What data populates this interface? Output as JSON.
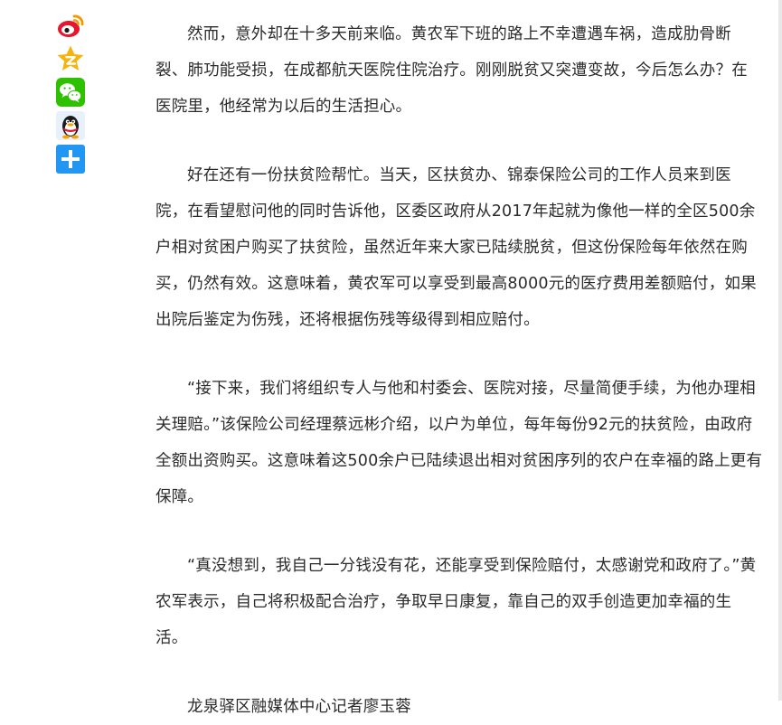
{
  "share": {
    "buttons": [
      {
        "name": "weibo-share-button",
        "icon": "weibo-icon",
        "color": "#e6162d"
      },
      {
        "name": "qzone-share-button",
        "icon": "qzone-star-icon",
        "color": "#f5b40d"
      },
      {
        "name": "wechat-share-button",
        "icon": "wechat-icon",
        "color": "#2dc100"
      },
      {
        "name": "qq-share-button",
        "icon": "qq-penguin-icon",
        "color": "#2a7bd3"
      },
      {
        "name": "more-share-button",
        "icon": "plus-icon",
        "color": "#2196f3"
      }
    ]
  },
  "article": {
    "paragraphs": [
      "然而，意外却在十多天前来临。黄农军下班的路上不幸遭遇车祸，造成肋骨断裂、肺功能受损，在成都航天医院住院治疗。刚刚脱贫又突遭变故，今后怎么办？在医院里，他经常为以后的生活担心。",
      "好在还有一份扶贫险帮忙。当天，区扶贫办、锦泰保险公司的工作人员来到医院，在看望慰问他的同时告诉他，区委区政府从2017年起就为像他一样的全区500余户相对贫困户购买了扶贫险，虽然近年来大家已陆续脱贫，但这份保险每年依然在购买，仍然有效。这意味着，黄农军可以享受到最高8000元的医疗费用差额赔付，如果出院后鉴定为伤残，还将根据伤残等级得到相应赔付。",
      "“接下来，我们将组织专人与他和村委会、医院对接，尽量简便手续，为他办理相关理赔。”该保险公司经理蔡远彬介绍，以户为单位，每年每份92元的扶贫险，由政府全额出资购买。这意味着这500余户已陆续退出相对贫困序列的农户在幸福的路上更有保障。",
      "“真没想到，我自己一分钱没有花，还能享受到保险赔付，太感谢党和政府了。”黄农军表示，自己将积极配合治疗，争取早日康复，靠自己的双手创造更加幸福的生活。"
    ],
    "byline": "龙泉驿区融媒体中心记者廖玉蓉"
  }
}
